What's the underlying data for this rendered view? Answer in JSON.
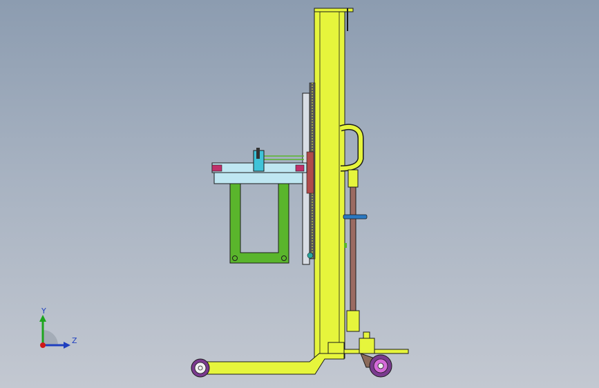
{
  "triad": {
    "y_label": "Y",
    "z_label": "Z"
  },
  "colors": {
    "background_top": "#8c9cb0",
    "background_bottom": "#c3c8d1",
    "mast": "#e6f53c",
    "frame_green": "#5ab52c",
    "carriage_blue": "#bfe7f2",
    "wheel_purple": "#7a3a8e",
    "handle_brown": "#9b6b62",
    "axis_y": "#1ea51e",
    "axis_z": "#1f3fbf",
    "axis_x": "#d01818"
  }
}
